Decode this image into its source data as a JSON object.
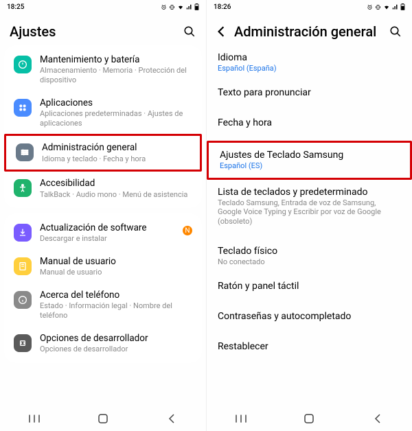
{
  "left": {
    "status_time": "18:25",
    "header_title": "Ajustes",
    "groups": [
      {
        "items": [
          {
            "icon": "battery-icon",
            "iconClass": "ic-teal",
            "title": "Mantenimiento y batería",
            "sub": "Almacenamiento · Memoria · Protección del dispositivo"
          },
          {
            "icon": "apps-icon",
            "iconClass": "ic-blue",
            "title": "Aplicaciones",
            "sub": "Aplicaciones predeterminadas · Ajustes de aplicaciones"
          },
          {
            "icon": "general-icon",
            "iconClass": "ic-slate",
            "title": "Administración general",
            "sub": "Idioma y teclado · Fecha y hora",
            "highlight": true
          },
          {
            "icon": "accessibility-icon",
            "iconClass": "ic-green",
            "title": "Accesibilidad",
            "sub": "TalkBack · Audio mono · Menú de asistencia"
          }
        ]
      },
      {
        "items": [
          {
            "icon": "update-icon",
            "iconClass": "ic-purple",
            "title": "Actualización de software",
            "sub": "Descargar e instalar",
            "badge": "N"
          },
          {
            "icon": "manual-icon",
            "iconClass": "ic-yellow",
            "title": "Manual de usuario",
            "sub": "Manual de usuario"
          },
          {
            "icon": "about-icon",
            "iconClass": "ic-grey",
            "title": "Acerca del teléfono",
            "sub": "Estado · Información legal · Nombre del teléfono"
          },
          {
            "icon": "dev-icon",
            "iconClass": "ic-dark",
            "title": "Opciones de desarrollador",
            "sub": "Opciones de desarrollador"
          }
        ]
      }
    ]
  },
  "right": {
    "status_time": "18:26",
    "header_title": "Administración general",
    "rows": [
      {
        "title": "Idioma",
        "sub": "Español (España)",
        "subBlue": true
      },
      {
        "title": "Texto para pronunciar"
      },
      {
        "divider": true
      },
      {
        "title": "Fecha y hora"
      },
      {
        "divider": true
      },
      {
        "title": "Ajustes de Teclado Samsung",
        "sub": "Español (ES)",
        "subBlue": true,
        "highlight": true
      },
      {
        "title": "Lista de teclados y predeterminado",
        "sub": "Teclado Samsung, Entrada de voz de Samsung, Google Voice Typing y Escribir por voz de Google (obsoleto)"
      },
      {
        "divider": true
      },
      {
        "title": "Teclado físico",
        "sub": "No conectado"
      },
      {
        "title": "Ratón y panel táctil"
      },
      {
        "divider": true
      },
      {
        "title": "Contraseñas y autocompletado"
      },
      {
        "divider": true
      },
      {
        "title": "Restablecer"
      }
    ]
  }
}
